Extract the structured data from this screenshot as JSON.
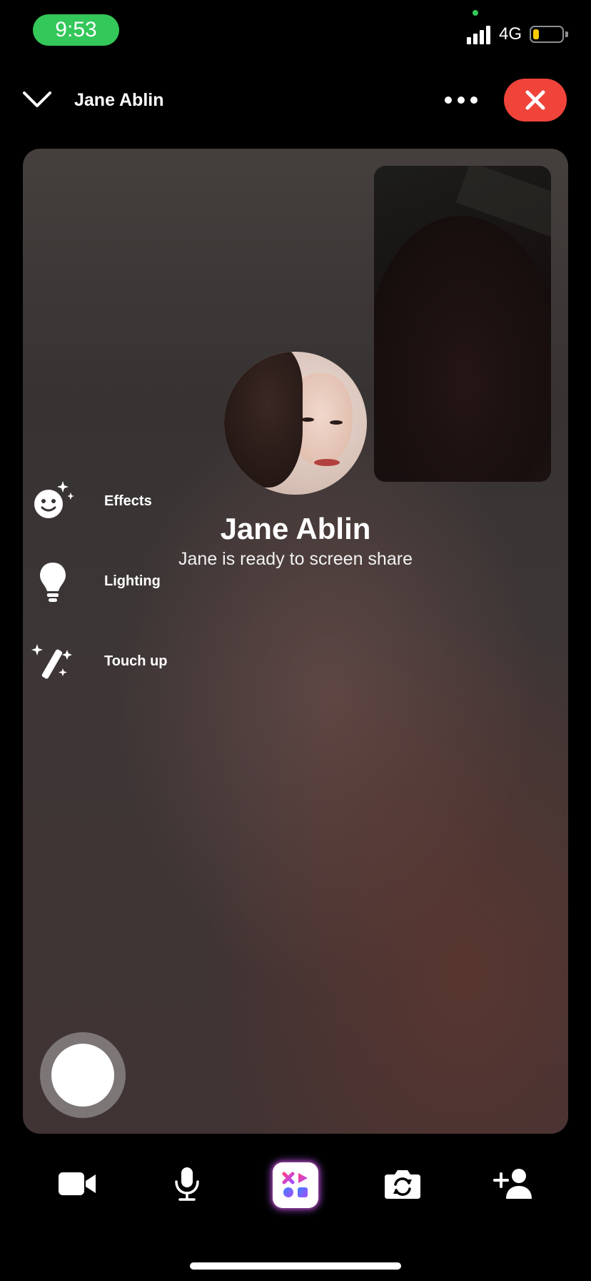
{
  "status_bar": {
    "time": "9:53",
    "network": "4G",
    "battery_level": 0.2,
    "colors": {
      "time_pill": "#34c759",
      "battery": "#ffcc00"
    }
  },
  "header": {
    "title": "Jane Ablin",
    "icons": {
      "collapse": "chevron-down-icon",
      "more": "more-icon",
      "end_call": "close-icon"
    },
    "colors": {
      "end_call": "#f0443b"
    }
  },
  "call": {
    "caller_name": "Jane Ablin",
    "status": "Jane is ready to screen share"
  },
  "tools": [
    {
      "label": "Effects",
      "icon": "smiley-sparkle-icon"
    },
    {
      "label": "Lighting",
      "icon": "lightbulb-icon"
    },
    {
      "label": "Touch up",
      "icon": "magic-wand-icon"
    }
  ],
  "toolbar": {
    "icons": [
      "video-camera-icon",
      "microphone-icon",
      "apps-icon",
      "flip-camera-icon",
      "add-person-icon"
    ]
  }
}
